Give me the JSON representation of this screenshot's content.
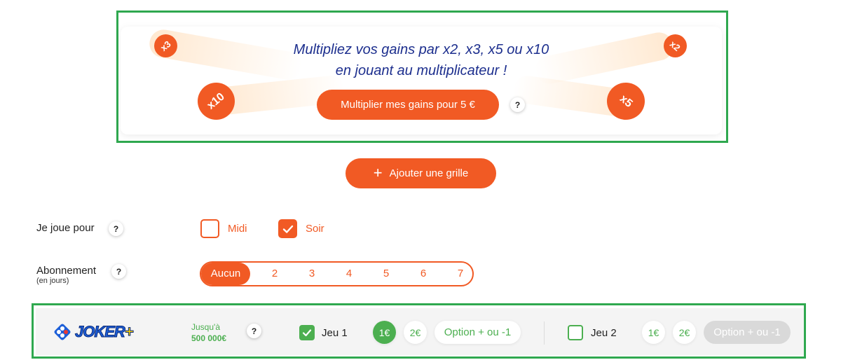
{
  "promo": {
    "line1": "Multipliez vos gains par x2, x3, x5 ou x10",
    "line2": "en jouant au multiplicateur !",
    "cta_label": "Multiplier mes gains pour 5 €",
    "help": "?",
    "badges": [
      "x3",
      "x2",
      "x10",
      "x5"
    ]
  },
  "add_grid": {
    "label": "Ajouter une grille",
    "icon": "plus-icon"
  },
  "draw_time": {
    "label": "Je joue pour",
    "help": "?",
    "options": [
      {
        "label": "Midi",
        "checked": false
      },
      {
        "label": "Soir",
        "checked": true
      }
    ]
  },
  "subscription": {
    "label": "Abonnement",
    "sublabel": "(en jours)",
    "help": "?",
    "options": [
      "Aucun",
      "2",
      "3",
      "4",
      "5",
      "6",
      "7"
    ],
    "selected": "Aucun"
  },
  "joker": {
    "logo_text": "JOKER",
    "logo_plus": "+",
    "up_to_label": "Jusqu'à",
    "jackpot": "500 000€",
    "help": "?",
    "games": [
      {
        "label": "Jeu 1",
        "checked": true,
        "stakes": [
          "1€",
          "2€"
        ],
        "selected_stake": "1€",
        "option_label": "Option + ou -1",
        "option_enabled": true
      },
      {
        "label": "Jeu 2",
        "checked": false,
        "stakes": [
          "1€",
          "2€"
        ],
        "selected_stake": null,
        "option_label": "Option + ou -1",
        "option_enabled": false
      }
    ]
  },
  "colors": {
    "accent": "#f15a24",
    "green": "#4caf50",
    "navy": "#1d2f8e",
    "frame": "#2fa84f"
  }
}
